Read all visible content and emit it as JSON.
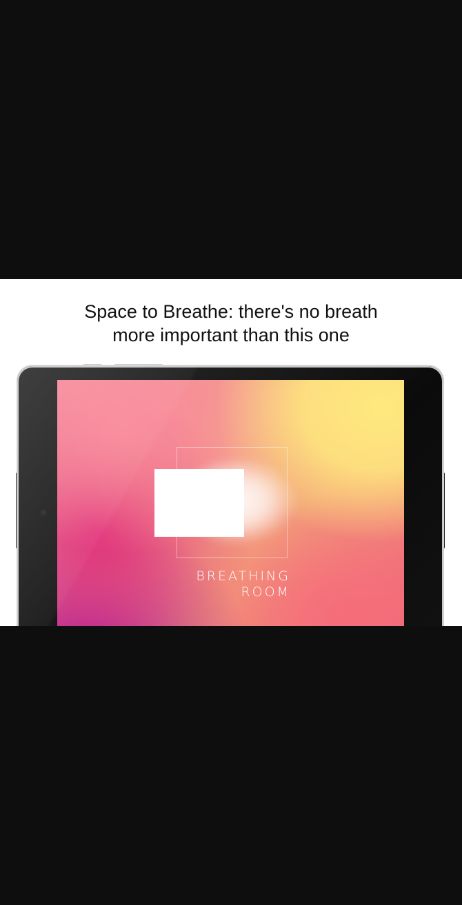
{
  "caption": {
    "line1": "Space to Breathe: there's no breath",
    "line2": "more important than this one"
  },
  "app_logo": {
    "line1": "BREATHING",
    "line2": "ROOM"
  },
  "colors": {
    "letterbox": "#0e0e0e",
    "promo_background": "#ffffff",
    "gradient_yellow": "#ffe97e",
    "gradient_pink": "#e0307a",
    "gradient_purple": "#a5169b",
    "gradient_coral": "#f56d7a"
  }
}
